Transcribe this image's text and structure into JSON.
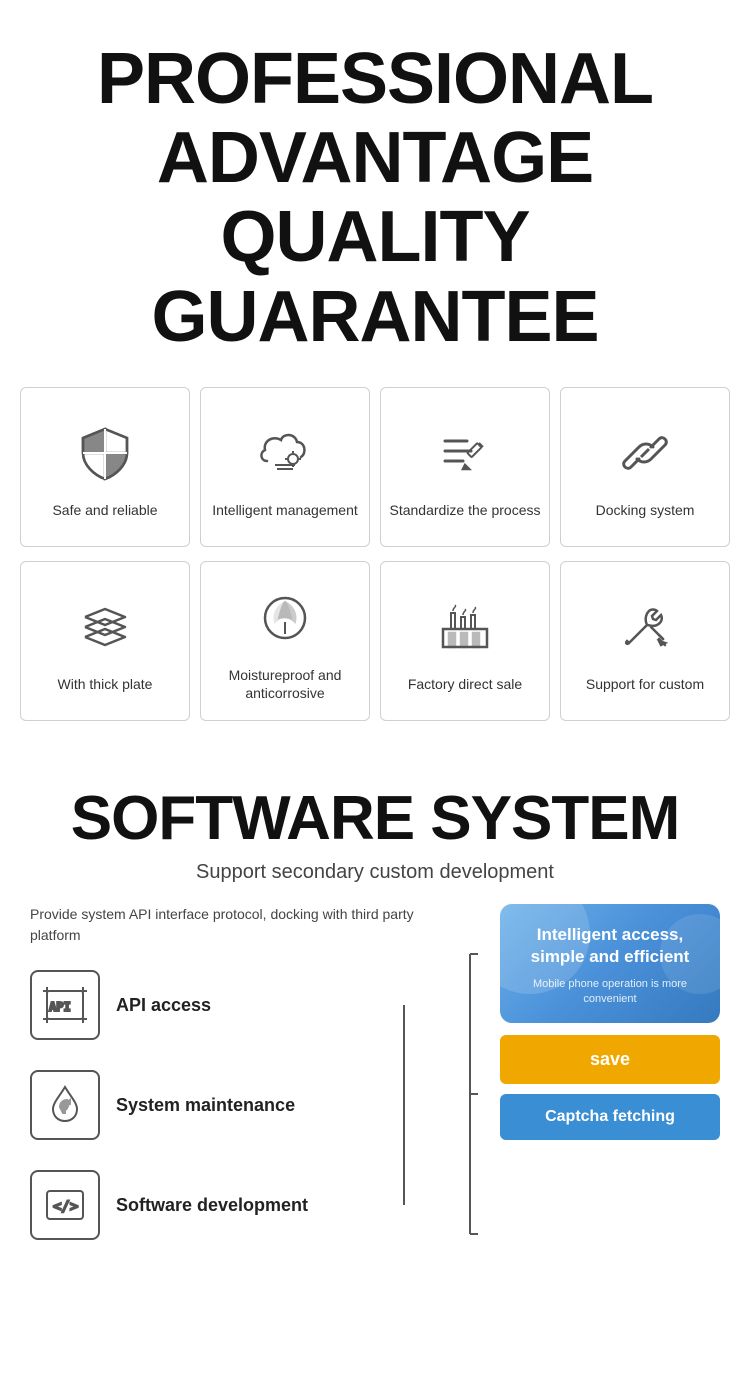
{
  "header": {
    "line1": "PROFESSIONAL",
    "line2": "ADVANTAGE",
    "line3": "QUALITY GUARANTEE"
  },
  "features_row1": [
    {
      "id": "safe-reliable",
      "label": "Safe and reliable",
      "icon": "shield"
    },
    {
      "id": "intelligent-management",
      "label": "Intelligent management",
      "icon": "cloud-settings"
    },
    {
      "id": "standardize-process",
      "label": "Standardize the process",
      "icon": "checklist"
    },
    {
      "id": "docking-system",
      "label": "Docking system",
      "icon": "link"
    }
  ],
  "features_row2": [
    {
      "id": "thick-plate",
      "label": "With thick plate",
      "icon": "layers"
    },
    {
      "id": "moistureproof",
      "label": "Moistureproof and anticorrosive",
      "icon": "leaf"
    },
    {
      "id": "factory-direct",
      "label": "Factory direct sale",
      "icon": "factory"
    },
    {
      "id": "support-custom",
      "label": "Support for custom",
      "icon": "tools"
    }
  ],
  "software": {
    "title": "SOFTWARE SYSTEM",
    "subtitle": "Support secondary custom development",
    "description": "Provide system API interface protocol, docking with third party platform",
    "items": [
      {
        "id": "api-access",
        "label": "API access",
        "icon": "api"
      },
      {
        "id": "system-maintenance",
        "label": "System maintenance",
        "icon": "wrench"
      },
      {
        "id": "software-development",
        "label": "Software development",
        "icon": "code"
      }
    ],
    "mockup": {
      "main_text": "Intelligent access, simple and efficient",
      "sub_text": "Mobile phone operation is more convenient"
    },
    "btn_save": "save",
    "btn_captcha": "Captcha fetching"
  }
}
